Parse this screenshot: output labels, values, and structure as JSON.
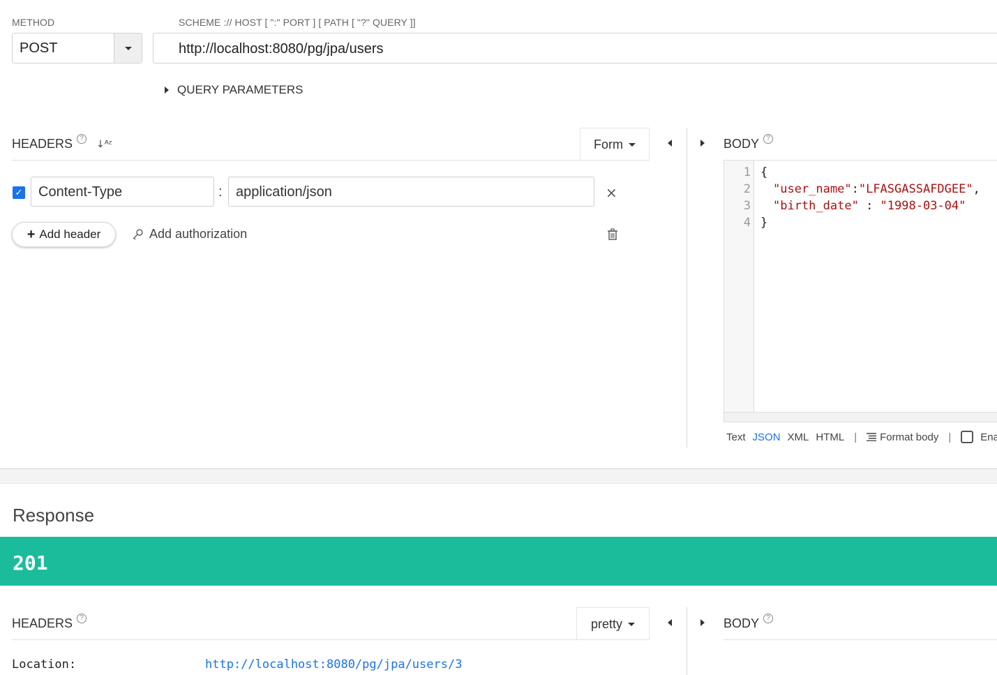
{
  "request": {
    "method_label": "METHOD",
    "method_value": "POST",
    "url_label": "SCHEME :// HOST [ \":\" PORT ] [ PATH [ \"?\" QUERY ]]",
    "url_value": "http://localhost:8080/pg/jpa/users",
    "query_params_label": "QUERY PARAMETERS"
  },
  "headers_panel": {
    "title": "HEADERS",
    "help": "?",
    "sort_icon": "sort-az-icon",
    "mode_label": "Form",
    "rows": [
      {
        "enabled": true,
        "name": "Content-Type",
        "separator": ":",
        "value": "application/json"
      }
    ],
    "add_header_label": "Add header",
    "add_auth_label": "Add authorization"
  },
  "body_panel": {
    "title": "BODY",
    "help": "?",
    "line_numbers": [
      "1",
      "2",
      "3",
      "4"
    ],
    "code": {
      "open": "{",
      "key1": "\"user_name\"",
      "sep1": ":",
      "val1": "\"LFASGASSAFDGEE\"",
      "tail1": ",",
      "key2": "\"birth_date\"",
      "sep2": " : ",
      "val2": "\"1998-03-04\"",
      "close": "}"
    },
    "toolbar": {
      "text": "Text",
      "json": "JSON",
      "xml": "XML",
      "html": "HTML",
      "divider": "|",
      "format_body": "Format body",
      "enable_trunc": "Ena"
    },
    "active_format": "JSON"
  },
  "response": {
    "title": "Response",
    "status_code": "201",
    "status_color": "#1abc9c",
    "headers_title": "HEADERS",
    "help": "?",
    "mode_label": "pretty",
    "body_title": "BODY",
    "headers": [
      {
        "key": "Location:",
        "value": "http://localhost:8080/pg/jpa/users/3"
      }
    ]
  },
  "colors": {
    "accent": "#1a73e8",
    "success": "#1abc9c",
    "string": "#aa1111"
  }
}
